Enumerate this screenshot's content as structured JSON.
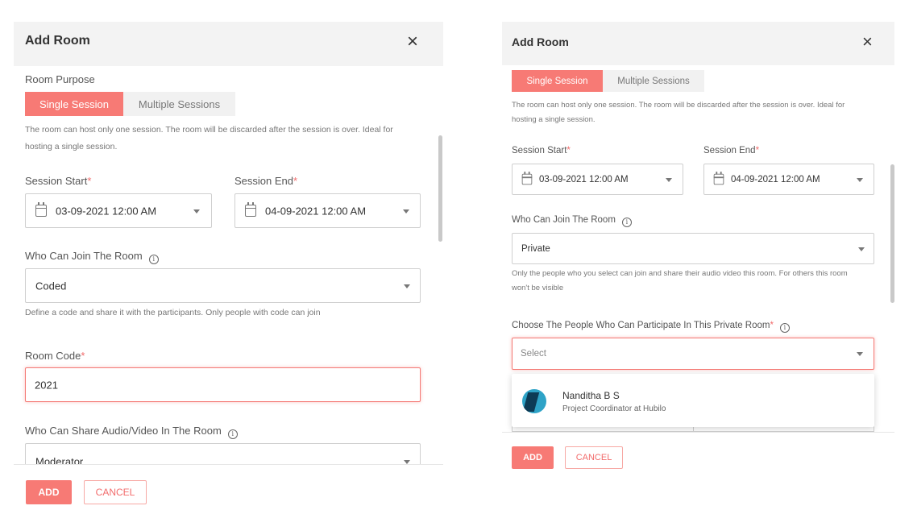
{
  "left": {
    "title": "Add Room",
    "room_purpose_label": "Room Purpose",
    "seg_single": "Single Session",
    "seg_multiple": "Multiple Sessions",
    "purpose_help_1": "The room can host only one session. The room will be discarded after the session is over. Ideal for",
    "purpose_help_2": "hosting a single session.",
    "start_label": "Session Start",
    "end_label": "Session End",
    "start_value": "03-09-2021 12:00 AM",
    "end_value": "04-09-2021 12:00 AM",
    "join_label": "Who Can Join The Room",
    "join_value": "Coded",
    "join_help": "Define a code and share it with the participants. Only people with code can join",
    "code_label": "Room Code",
    "code_value": "2021",
    "share_label": "Who Can Share Audio/Video In The Room",
    "share_value": "Moderator",
    "add_label": "ADD",
    "cancel_label": "CANCEL"
  },
  "right": {
    "title": "Add Room",
    "seg_single": "Single Session",
    "seg_multiple": "Multiple Sessions",
    "purpose_help_1": "The room can host only one session. The room will be discarded after the session is over. Ideal for",
    "purpose_help_2": "hosting a single session.",
    "start_label": "Session Start",
    "end_label": "Session End",
    "start_value": "03-09-2021 12:00 AM",
    "end_value": "04-09-2021 12:00 AM",
    "join_label": "Who Can Join The Room",
    "join_value": "Private",
    "join_help_1": "Only the people who you select can join and share their audio video this room. For others this room",
    "join_help_2": "won't be visible",
    "people_label": "Choose The People Who Can Participate In This Private Room",
    "people_placeholder": "Select",
    "option_name": "Nanditha B S",
    "option_role": "Project Coordinator at Hubilo",
    "add_label": "ADD",
    "cancel_label": "CANCEL"
  },
  "common": {
    "required_mark": "*",
    "info_glyph": "i"
  },
  "colors": {
    "accent": "#f77a75",
    "header_bg": "#f3f3f3"
  }
}
